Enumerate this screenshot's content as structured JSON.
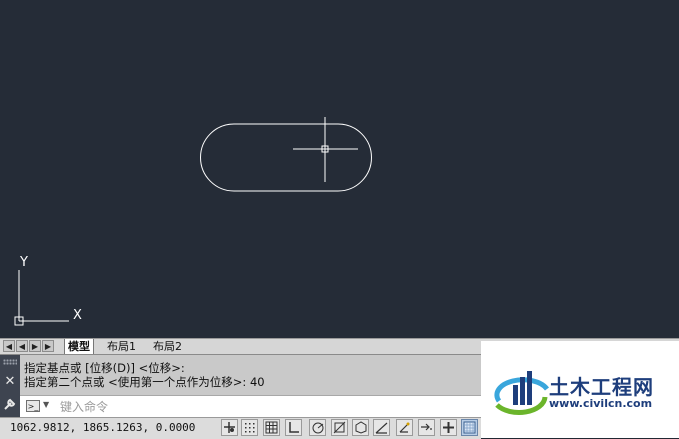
{
  "canvas": {
    "background": "#252c37",
    "ucs": {
      "x_label": "X",
      "y_label": "Y"
    }
  },
  "layout_tabs": {
    "nav_buttons": [
      "first-tab",
      "previous-tab",
      "next-tab",
      "last-tab"
    ],
    "tabs": [
      {
        "label": "模型",
        "active": true
      },
      {
        "label": "布局1",
        "active": false
      },
      {
        "label": "布局2",
        "active": false
      }
    ]
  },
  "command_line": {
    "history": [
      "指定基点或 [位移(D)] <位移>:",
      "指定第二个点或 <使用第一个点作为位移>: 40"
    ],
    "placeholder": "键入命令",
    "icons": [
      "close-icon",
      "settings-icon",
      "command-prompt-icon"
    ]
  },
  "status_bar": {
    "coordinates": "1062.9812, 1865.1263, 0.0000",
    "toggles": [
      {
        "name": "infer-constraints",
        "on": false
      },
      {
        "name": "snap-mode",
        "on": false
      },
      {
        "name": "grid-display",
        "on": false
      },
      {
        "name": "ortho-mode",
        "on": false
      },
      {
        "name": "polar-tracking",
        "on": false
      },
      {
        "name": "object-snap",
        "on": false
      },
      {
        "name": "3d-object-snap",
        "on": false
      },
      {
        "name": "object-snap-tracking",
        "on": false
      },
      {
        "name": "dynamic-ucs",
        "on": false
      },
      {
        "name": "dynamic-input",
        "on": false
      },
      {
        "name": "lineweight",
        "on": false
      },
      {
        "name": "transparency",
        "on": false
      },
      {
        "name": "quick-properties",
        "on": true
      }
    ]
  },
  "watermark": {
    "title": "土木工程网",
    "url": "www.civilcn.com",
    "colors": {
      "blue": "#1e3e7c",
      "green": "#6bb52b",
      "light_blue": "#39a6dc"
    }
  }
}
